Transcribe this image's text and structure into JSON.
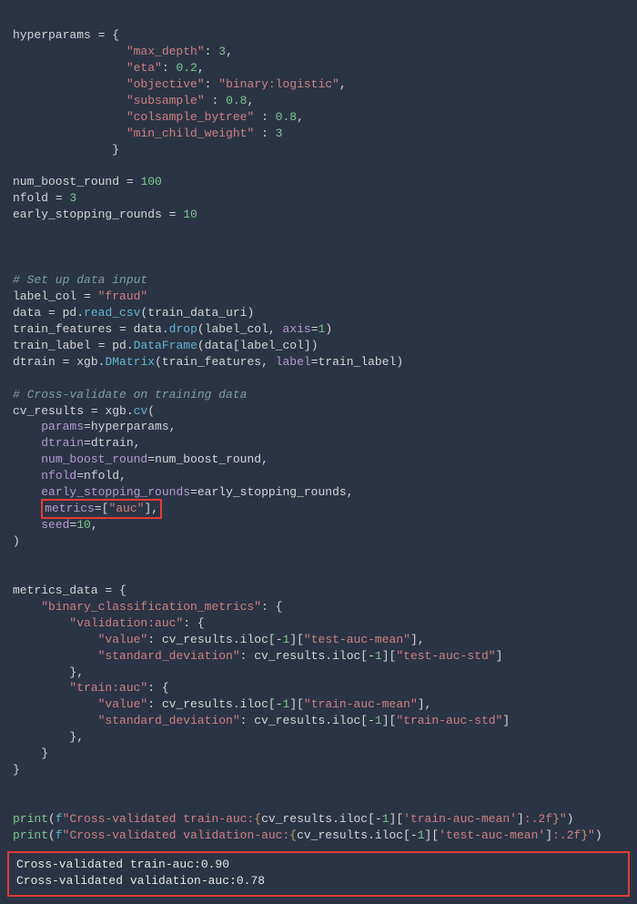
{
  "code": {
    "l1a": "hyperparams ",
    "l1op": "=",
    "l1b": " {",
    "l2k": "\"max_depth\"",
    "l2c": ": ",
    "l2v": "3",
    "l2e": ",",
    "l3k": "\"eta\"",
    "l3c": ": ",
    "l3v": "0.2",
    "l3e": ",",
    "l4k": "\"objective\"",
    "l4c": ": ",
    "l4v": "\"binary:logistic\"",
    "l4e": ",",
    "l5k": "\"subsample\"",
    "l5c": " : ",
    "l5v": "0.8",
    "l5e": ",",
    "l6k": "\"colsample_bytree\"",
    "l6c": " : ",
    "l6v": "0.8",
    "l6e": ",",
    "l7k": "\"min_child_weight\"",
    "l7c": " : ",
    "l7v": "3",
    "l8": "              }",
    "l10a": "num_boost_round ",
    "l10op": "=",
    "l10v": " 100",
    "l11a": "nfold ",
    "l11op": "=",
    "l11v": " 3",
    "l12a": "early_stopping_rounds ",
    "l12op": "=",
    "l12v": " 10",
    "l16c": "# Set up data input",
    "l17a": "label_col ",
    "l17op": "=",
    "l17v": " \"fraud\"",
    "l18a": "data ",
    "l18op": "=",
    "l18b": " pd",
    "l18dot": ".",
    "l18f": "read_csv",
    "l18p": "(train_data_uri)",
    "l19a": "train_features ",
    "l19op": "=",
    "l19b": " data",
    "l19dot": ".",
    "l19f": "drop",
    "l19p1": "(label_col, ",
    "l19kw": "axis",
    "l19eq": "=",
    "l19n": "1",
    "l19p2": ")",
    "l20a": "train_label ",
    "l20op": "=",
    "l20b": " pd",
    "l20dot": ".",
    "l20f": "DataFrame",
    "l20p": "(data[label_col])",
    "l21a": "dtrain ",
    "l21op": "=",
    "l21b": " xgb",
    "l21dot": ".",
    "l21f": "DMatrix",
    "l21p1": "(train_features, ",
    "l21kw": "label",
    "l21eq": "=",
    "l21p2": "train_label)",
    "l23c": "# Cross-validate on training data",
    "l24a": "cv_results ",
    "l24op": "=",
    "l24b": " xgb",
    "l24dot": ".",
    "l24f": "cv",
    "l24p": "(",
    "l25k": "params",
    "l25e": "=",
    "l25v": "hyperparams,",
    "l26k": "dtrain",
    "l26e": "=",
    "l26v": "dtrain,",
    "l27k": "num_boost_round",
    "l27e": "=",
    "l27v": "num_boost_round,",
    "l28k": "nfold",
    "l28e": "=",
    "l28v": "nfold,",
    "l29k": "early_stopping_rounds",
    "l29e": "=",
    "l29v": "early_stopping_rounds,",
    "l30k": "metrics",
    "l30e": "=",
    "l30b1": "[",
    "l30s": "\"auc\"",
    "l30b2": "]",
    "l30c": ",",
    "l31k": "seed",
    "l31e": "=",
    "l31v": "10",
    "l31c": ",",
    "l32": ")",
    "l35a": "metrics_data ",
    "l35op": "=",
    "l35b": " {",
    "l36k": "\"binary_classification_metrics\"",
    "l36c": ": {",
    "l37k": "\"validation:auc\"",
    "l37c": ": {",
    "l38k": "\"value\"",
    "l38c": ": cv_results",
    "l38dot": ".",
    "l38il": "iloc[",
    "l38n": "-",
    "l38n1": "1",
    "l38br": "][",
    "l38s": "\"test-auc-mean\"",
    "l38e": "],",
    "l39k": "\"standard_deviation\"",
    "l39c": ": cv_results",
    "l39dot": ".",
    "l39il": "iloc[",
    "l39n": "-",
    "l39n1": "1",
    "l39br": "][",
    "l39s": "\"test-auc-std\"",
    "l39e": "]",
    "l40": "        },",
    "l41k": "\"train:auc\"",
    "l41c": ": {",
    "l42k": "\"value\"",
    "l42c": ": cv_results",
    "l42dot": ".",
    "l42il": "iloc[",
    "l42n": "-",
    "l42n1": "1",
    "l42br": "][",
    "l42s": "\"train-auc-mean\"",
    "l42e": "],",
    "l43k": "\"standard_deviation\"",
    "l43c": ": cv_results",
    "l43dot": ".",
    "l43il": "iloc[",
    "l43n": "-",
    "l43n1": "1",
    "l43br": "][",
    "l43s": "\"train-auc-std\"",
    "l43e": "]",
    "l44": "        },",
    "l45": "    }",
    "l46": "}",
    "p1_print": "print",
    "p1_open": "(",
    "p1_f": "f",
    "p1_s1": "\"Cross-validated train-auc:",
    "p1_cb1": "{",
    "p1_expr": "cv_results.iloc[",
    "p1_neg": "-",
    "p1_one": "1",
    "p1_br": "][",
    "p1_key": "'train-auc-mean'",
    "p1_cl": "]",
    "p1_fmt": ":.2f",
    "p1_cb2": "}",
    "p1_s2": "\"",
    "p1_close": ")",
    "p2_print": "print",
    "p2_open": "(",
    "p2_f": "f",
    "p2_s1": "\"Cross-validated validation-auc:",
    "p2_cb1": "{",
    "p2_expr": "cv_results.iloc[",
    "p2_neg": "-",
    "p2_one": "1",
    "p2_br": "][",
    "p2_key": "'test-auc-mean'",
    "p2_cl": "]",
    "p2_fmt": ":.2f",
    "p2_cb2": "}",
    "p2_s2": "\"",
    "p2_close": ")"
  },
  "output": {
    "line1": "Cross-validated train-auc:0.90",
    "line2": "Cross-validated validation-auc:0.78"
  },
  "chart_data": {
    "type": "table",
    "title": "Cross-validated AUC results",
    "rows": [
      {
        "metric": "train-auc",
        "value": 0.9
      },
      {
        "metric": "validation-auc",
        "value": 0.78
      }
    ],
    "hyperparameters": {
      "max_depth": 3,
      "eta": 0.2,
      "objective": "binary:logistic",
      "subsample": 0.8,
      "colsample_bytree": 0.8,
      "min_child_weight": 3,
      "num_boost_round": 100,
      "nfold": 3,
      "early_stopping_rounds": 10,
      "seed": 10,
      "metrics": [
        "auc"
      ]
    }
  }
}
